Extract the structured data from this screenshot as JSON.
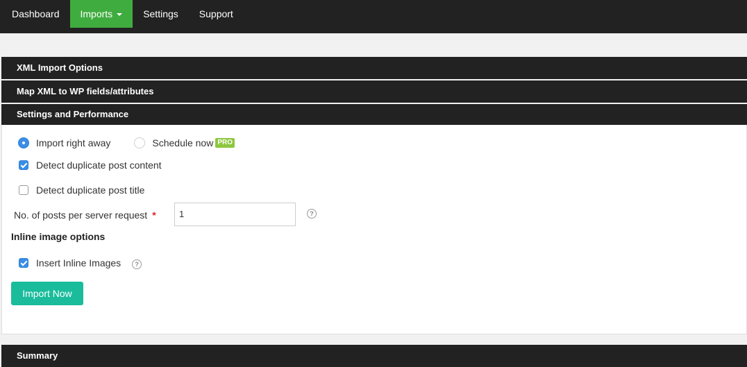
{
  "nav": {
    "dashboard": "Dashboard",
    "imports": "Imports",
    "settings": "Settings",
    "support": "Support"
  },
  "sections": {
    "xml_import_options": "XML Import Options",
    "map_fields": "Map XML to WP fields/attributes",
    "settings_performance": "Settings and Performance",
    "summary": "Summary"
  },
  "form": {
    "import_mode": {
      "import_right_away": "Import right away",
      "schedule_now": "Schedule now",
      "pro_badge": "PRO",
      "selected": "import_right_away"
    },
    "detect_duplicate_content": {
      "label": "Detect duplicate post content",
      "checked": true
    },
    "detect_duplicate_title": {
      "label": "Detect duplicate post title",
      "checked": false
    },
    "posts_per_request": {
      "label": "No. of posts per server request",
      "required_mark": "*",
      "value": "1"
    },
    "help_glyph": "?",
    "inline_images_title": "Inline image options",
    "insert_inline_images": {
      "label": "Insert Inline Images",
      "checked": true
    },
    "import_button": "Import Now"
  },
  "colors": {
    "nav_bg": "#222222",
    "nav_active": "#3fac3f",
    "accent_blue": "#3a8ee6",
    "button_teal": "#1abc9c",
    "pro_green": "#8dc63f",
    "required_red": "#d9272e"
  }
}
